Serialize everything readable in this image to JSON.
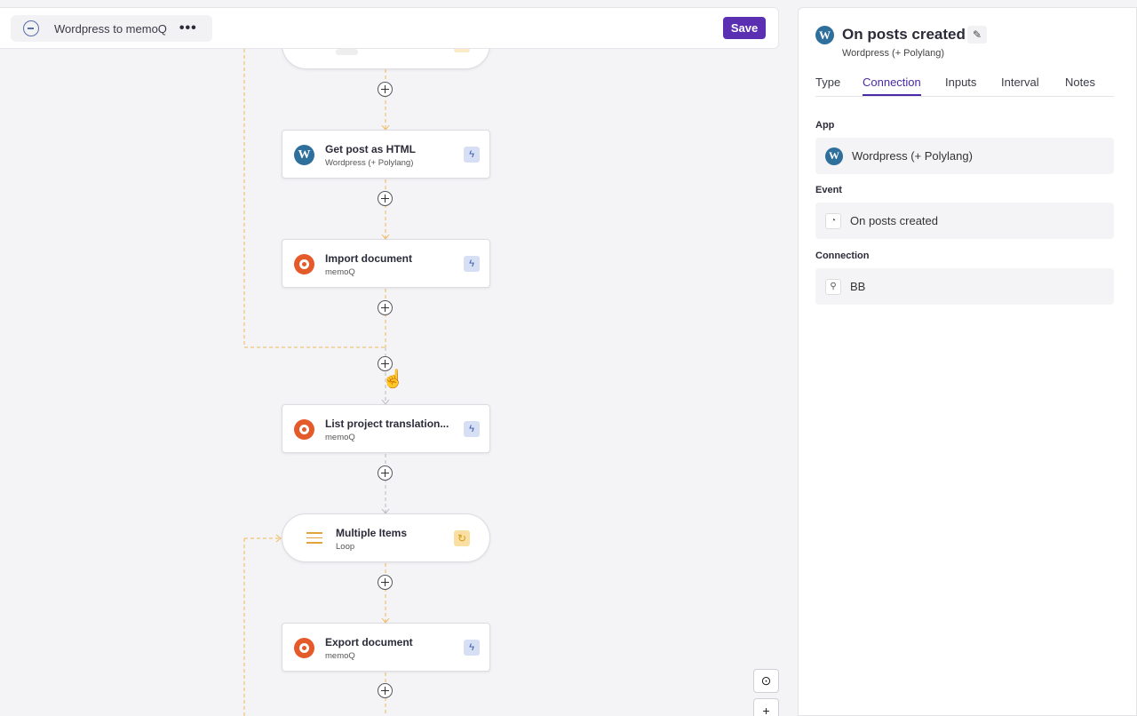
{
  "workflow": {
    "name": "Wordpress to memoQ",
    "more_label": "•••",
    "save_label": "Save"
  },
  "nodes": [
    {
      "title": "Get post as HTML",
      "subtitle": "Wordpress (+ Polylang)",
      "app": "wordpress"
    },
    {
      "title": "Import document",
      "subtitle": "memoQ",
      "app": "memoq"
    },
    {
      "title": "List project translation...",
      "subtitle": "memoQ",
      "app": "memoq"
    },
    {
      "title": "Multiple Items",
      "subtitle": "Loop",
      "app": "loop"
    },
    {
      "title": "Export document",
      "subtitle": "memoQ",
      "app": "memoq"
    }
  ],
  "panel": {
    "title": "On posts created",
    "subtitle": "Wordpress (+ Polylang)",
    "tabs": [
      "Type",
      "Connection",
      "Inputs",
      "Interval",
      "Notes"
    ],
    "active_tab": "Connection",
    "fields": [
      {
        "label": "App",
        "value": "Wordpress (+ Polylang)",
        "icon": "wordpress-icon"
      },
      {
        "label": "Event",
        "value": "On posts created",
        "icon": "rss-icon"
      },
      {
        "label": "Connection",
        "value": "BB",
        "icon": "link-icon"
      }
    ]
  },
  "colors": {
    "accent": "#5b2fb2",
    "connector": "#f0b85a",
    "wordpress": "#2e6f9c",
    "memoq": "#e45a2a"
  }
}
